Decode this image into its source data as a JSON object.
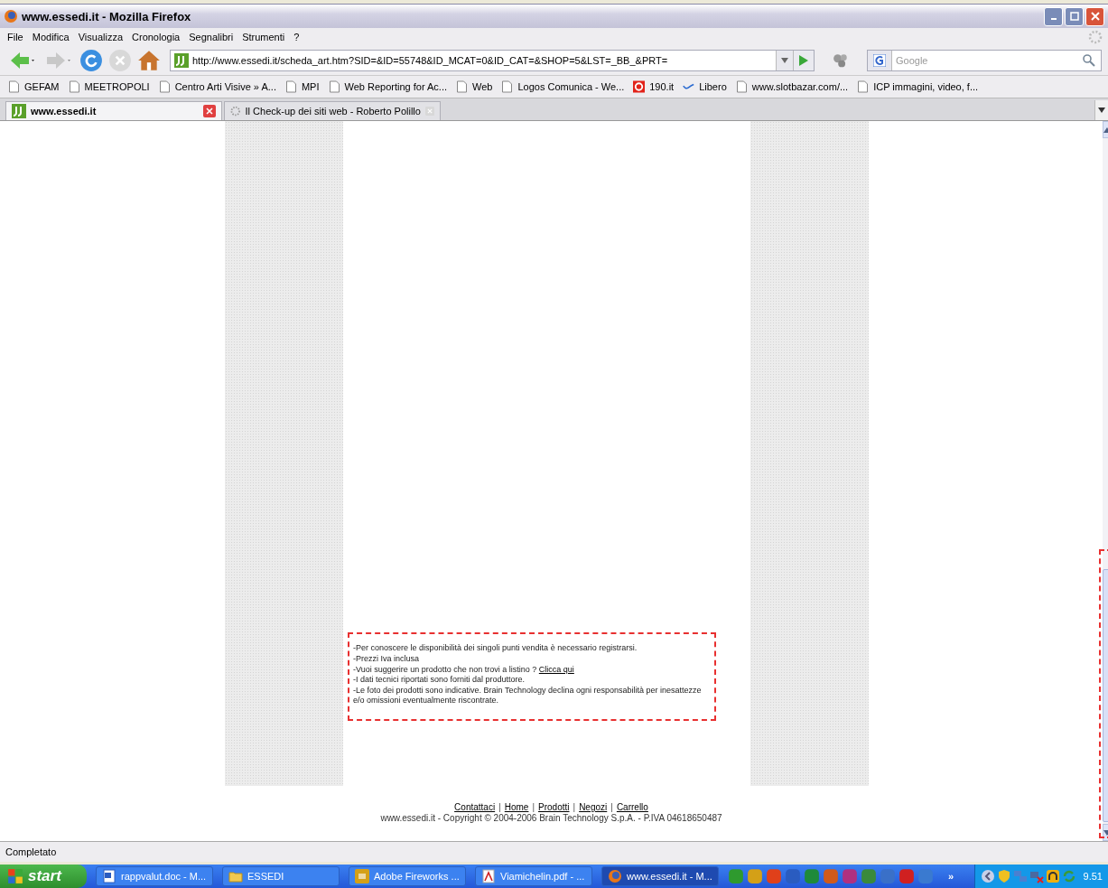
{
  "window": {
    "title": "www.essedi.it - Mozilla Firefox"
  },
  "menu": [
    {
      "label": "File"
    },
    {
      "label": "Modifica"
    },
    {
      "label": "Visualizza"
    },
    {
      "label": "Cronologia"
    },
    {
      "label": "Segnalibri"
    },
    {
      "label": "Strumenti"
    },
    {
      "label": "?"
    }
  ],
  "toolbar": {
    "url": "http://www.essedi.it/scheda_art.htm?SID=&ID=55748&ID_MCAT=0&ID_CAT=&SHOP=5&LST=_BB_&PRT=",
    "search_placeholder": "Google"
  },
  "bookmarks": [
    {
      "label": "GEFAM",
      "kind": "page"
    },
    {
      "label": "MEETROPOLI",
      "kind": "page"
    },
    {
      "label": "Centro Arti Visive » A...",
      "kind": "page"
    },
    {
      "label": "MPI",
      "kind": "page"
    },
    {
      "label": "Web Reporting for Ac...",
      "kind": "page"
    },
    {
      "label": "Web",
      "kind": "page"
    },
    {
      "label": "Logos Comunica - We...",
      "kind": "page"
    },
    {
      "label": "190.it",
      "kind": "ring"
    },
    {
      "label": "Libero",
      "kind": "wave"
    },
    {
      "label": "www.slotbazar.com/...",
      "kind": "page"
    },
    {
      "label": "ICP immagini, video, f...",
      "kind": "page"
    }
  ],
  "tabs": [
    {
      "label": "www.essedi.it",
      "selected": true,
      "kind": "site"
    },
    {
      "label": "Il Check-up dei siti web - Roberto Polillo",
      "selected": false,
      "kind": "loading"
    }
  ],
  "notes": [
    {
      "text": "-Per conoscere le disponibilità dei singoli punti vendita è necessario registrarsi."
    },
    {
      "text": "-Prezzi Iva inclusa"
    },
    {
      "text": "-Vuoi suggerire un prodotto che non trovi a listino ?",
      "link": "Clicca qui"
    },
    {
      "text": "-I dati tecnici riportati sono forniti dal produttore."
    },
    {
      "text": "-Le foto dei prodotti sono indicative. Brain Technology declina ogni responsabilità per inesattezze e/o omissioni eventualmente riscontrate."
    }
  ],
  "footer": {
    "links": [
      "Contattaci",
      "Home",
      "Prodotti",
      "Negozi",
      "Carrello"
    ],
    "separator": "|",
    "copyright": "www.essedi.it - Copyright © 2004-2006 Brain Technology S.p.A. - P.IVA 04618650487"
  },
  "status_bar": {
    "text": "Completato"
  },
  "taskbar": {
    "start": "start",
    "tasks": [
      {
        "label": "rappvalut.doc - M...",
        "kind": "word",
        "selected": false
      },
      {
        "label": "ESSEDI",
        "kind": "folder",
        "selected": false
      },
      {
        "label": "Adobe Fireworks ...",
        "kind": "fireworks",
        "selected": false
      },
      {
        "label": "Viamichelin.pdf - ...",
        "kind": "pdf",
        "selected": false
      },
      {
        "label": "www.essedi.it - M...",
        "kind": "firefox",
        "selected": true
      }
    ],
    "quick_launch": [
      {
        "color": "#2e9a2e"
      },
      {
        "color": "#d4a017"
      },
      {
        "color": "#e0401a"
      },
      {
        "color": "#2a5cc0"
      },
      {
        "color": "#1e8a3a"
      },
      {
        "color": "#d05a1a"
      },
      {
        "color": "#b03080"
      },
      {
        "color": "#3a8a3a"
      },
      {
        "color": "#3a70c8"
      },
      {
        "color": "#d02020"
      },
      {
        "color": "#3a7ad0"
      }
    ],
    "overflow": "»",
    "clock": "9.51"
  }
}
